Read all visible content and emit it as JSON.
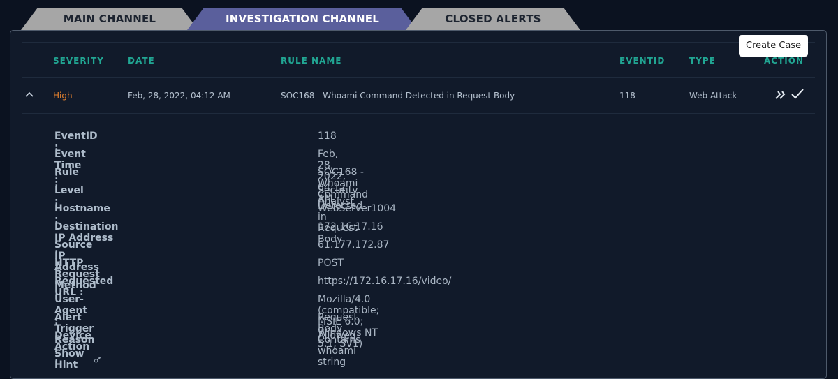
{
  "tabs": {
    "main": "MAIN CHANNEL",
    "investigation": "INVESTIGATION CHANNEL",
    "closed": "CLOSED ALERTS"
  },
  "columns": {
    "severity": "SEVERITY",
    "date": "DATE",
    "rule": "RULE NAME",
    "eventid": "EVENTID",
    "type": "TYPE",
    "action": "ACTION"
  },
  "alert": {
    "severity": "High",
    "date": "Feb, 28, 2022, 04:12 AM",
    "rule": "SOC168 - Whoami Command Detected in Request Body",
    "eventid": "118",
    "type": "Web Attack"
  },
  "tooltip": "Create Case",
  "details": [
    {
      "label": "EventID :",
      "value": "118"
    },
    {
      "label": "Event Time :",
      "value": "Feb, 28, 2022, 04:12 AM"
    },
    {
      "label": "Rule :",
      "value": "SOC168 - Whoami Command Detected in Request Body"
    },
    {
      "label": "Level :",
      "value": "Security Analyst"
    },
    {
      "label": "Hostname :",
      "value": "WebServer1004"
    },
    {
      "label": "Destination IP Address :",
      "value": "172.16.17.16"
    },
    {
      "label": "Source IP Address :",
      "value": "61.177.172.87"
    },
    {
      "label": "HTTP Request Method :",
      "value": "POST"
    },
    {
      "label": "Requested URL :",
      "value": "https://172.16.17.16/video/"
    },
    {
      "label": "User-Agent :",
      "value": "Mozilla/4.0 (compatible; MSIE 6.0; Windows NT 5.1; SV1)"
    },
    {
      "label": "Alert Trigger Reason :",
      "value": "Request Body Contains whoami string"
    },
    {
      "label": "Device Action :",
      "value": "Allowed"
    }
  ],
  "show_hint": "Show Hint",
  "colors": {
    "background": "#0b1220",
    "panel": "#111a2a",
    "accent_teal": "#21a693",
    "severity_high": "#e7822e",
    "active_tab": "#5a5f9c",
    "inactive_tab": "#a9a9a9"
  },
  "icons": {
    "collapse": "chevron-up-icon",
    "escalate": "double-chevron-right-icon",
    "close": "check-icon",
    "hint": "key-icon"
  }
}
